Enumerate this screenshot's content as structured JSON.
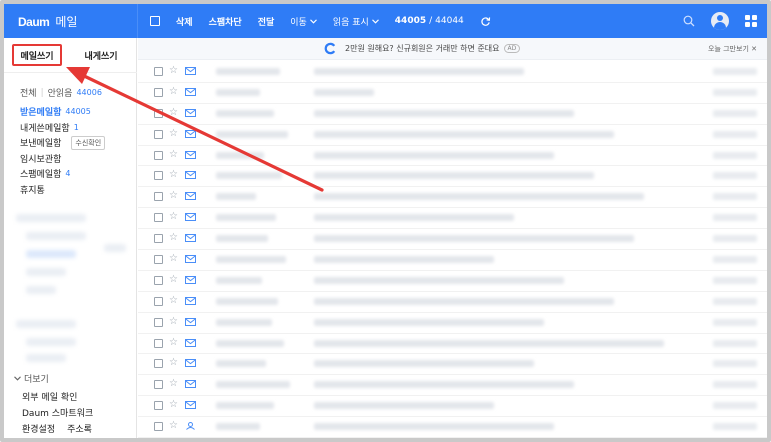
{
  "app": {
    "brand": "Daum",
    "brand_sub": "메일"
  },
  "toolbar": {
    "delete": "삭제",
    "spam_block": "스팸차단",
    "forward": "전달",
    "move": "이동",
    "read_display": "읽음 표시",
    "unread": "44005",
    "separator": "/",
    "total": "44044"
  },
  "sidebar": {
    "compose": "메일쓰기",
    "compose_self": "내게쓰기",
    "filter_all": "전체",
    "filter_unread": "안읽음",
    "filter_unread_count": "44006",
    "folders": [
      {
        "label": "받은메일함",
        "count": "44005",
        "active": true
      },
      {
        "label": "내게쓴메일함",
        "count": "1"
      },
      {
        "label": "보낸메일함",
        "tag": "수신확인"
      },
      {
        "label": "임시보관함"
      },
      {
        "label": "스팸메일함",
        "count": "4"
      },
      {
        "label": "휴지통"
      }
    ],
    "more": "더보기",
    "external_mail": "외부 메일 확인",
    "smartwork": "Daum 스마트워크",
    "settings": "환경설정",
    "address_book": "주소록"
  },
  "notice": {
    "text": "2만원 원해요? 신규회원은 거래만 하면 준대요",
    "ad": "AD",
    "close": "오늘 그만보기"
  },
  "mail_rows": [
    {
      "icon": "envelope"
    },
    {
      "icon": "envelope"
    },
    {
      "icon": "envelope"
    },
    {
      "icon": "envelope"
    },
    {
      "icon": "envelope"
    },
    {
      "icon": "envelope"
    },
    {
      "icon": "envelope"
    },
    {
      "icon": "envelope"
    },
    {
      "icon": "envelope"
    },
    {
      "icon": "envelope"
    },
    {
      "icon": "envelope"
    },
    {
      "icon": "envelope"
    },
    {
      "icon": "envelope"
    },
    {
      "icon": "envelope"
    },
    {
      "icon": "envelope"
    },
    {
      "icon": "envelope"
    },
    {
      "icon": "envelope"
    },
    {
      "icon": "person"
    },
    {
      "icon": "envelope"
    }
  ],
  "colors": {
    "topbar": "#2f7cf6",
    "highlight": "#e53935",
    "arrow": "#e53935"
  }
}
